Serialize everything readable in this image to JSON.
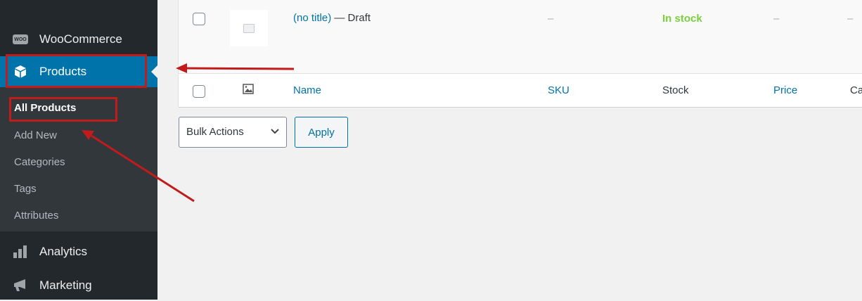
{
  "sidebar": {
    "woocommerce_label": "WooCommerce",
    "woocommerce_badge": "WOO",
    "products_label": "Products",
    "submenu": [
      "All Products",
      "Add New",
      "Categories",
      "Tags",
      "Attributes"
    ],
    "analytics_label": "Analytics",
    "marketing_label": "Marketing"
  },
  "table": {
    "row": {
      "title": "(no title)",
      "status": " — Draft",
      "sku": "–",
      "stock": "In stock",
      "price": "–",
      "extra": "–"
    },
    "headers": {
      "name": "Name",
      "sku": "SKU",
      "stock": "Stock",
      "price": "Price",
      "categories_partial": "Ca"
    }
  },
  "actions": {
    "bulk_label": "Bulk Actions",
    "apply_label": "Apply"
  },
  "colors": {
    "sidebar_bg": "#23282d",
    "active_menu": "#0073aa",
    "annotation": "#c11b1b",
    "in_stock": "#7ad03a"
  }
}
